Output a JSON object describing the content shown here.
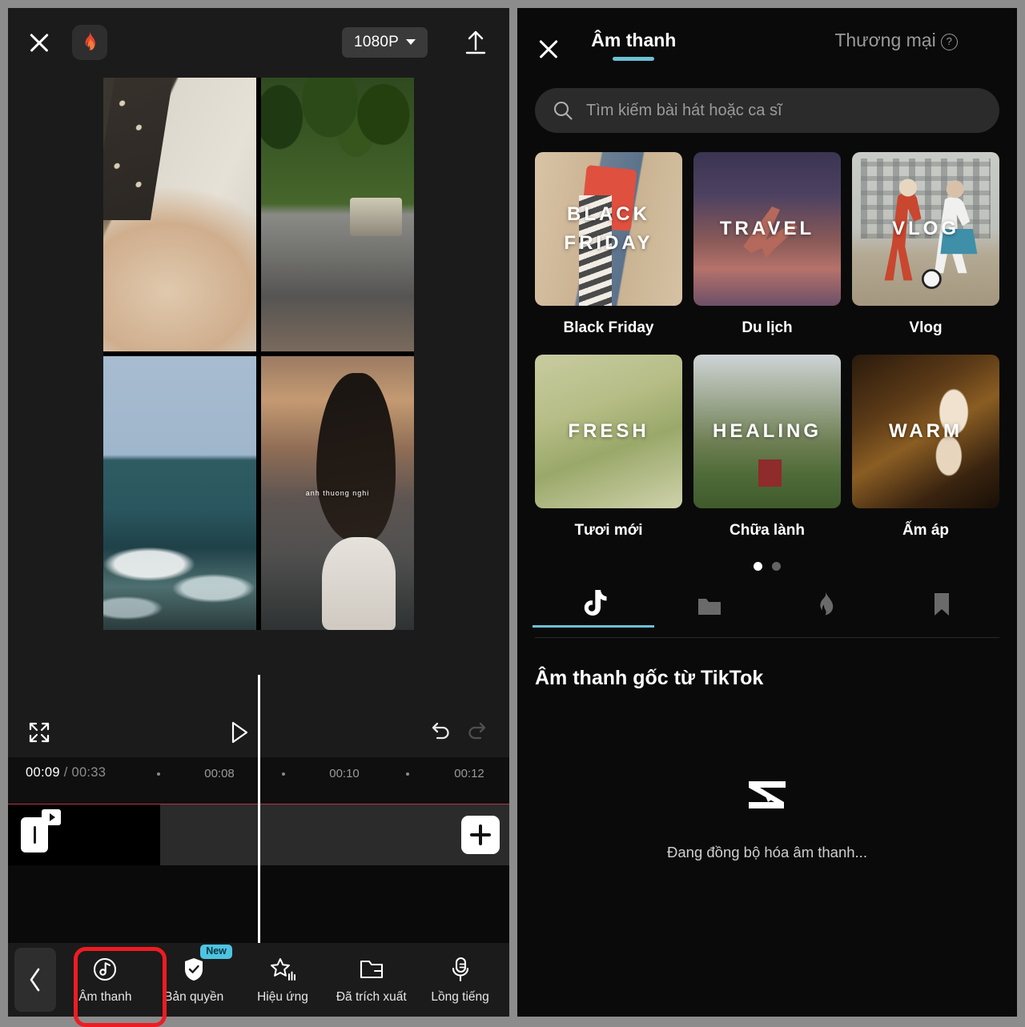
{
  "editor": {
    "close_label": "×",
    "brand_icon": "flame-icon",
    "resolution": "1080P",
    "export_icon": "upload-icon",
    "preview": {
      "cells": [
        {
          "name": "cat-clip",
          "caption": ""
        },
        {
          "name": "street-clip",
          "caption": ""
        },
        {
          "name": "sea-clip",
          "caption": ""
        },
        {
          "name": "girl-clip",
          "caption": "anh thuong nghi"
        }
      ]
    },
    "controls": {
      "fullscreen_icon": "expand-icon",
      "play_icon": "play-icon",
      "undo_icon": "undo-icon",
      "redo_icon": "redo-icon"
    },
    "timeline": {
      "current_time": "00:09",
      "separator": "/",
      "total_time": "00:33",
      "ticks": [
        "00:08",
        "00:10",
        "00:12"
      ],
      "add_label": "+"
    },
    "toolbar": {
      "back_icon": "chevron-left-icon",
      "items": [
        {
          "label": "Âm thanh",
          "icon": "music-note-icon",
          "badge": "",
          "highlighted": true
        },
        {
          "label": "Bản quyền",
          "icon": "shield-check-icon",
          "badge": "New",
          "highlighted": false
        },
        {
          "label": "Hiệu ứng",
          "icon": "star-effect-icon",
          "badge": "",
          "highlighted": false
        },
        {
          "label": "Đã trích xuất",
          "icon": "folder-extract-icon",
          "badge": "",
          "highlighted": false
        },
        {
          "label": "Lồng tiếng",
          "icon": "microphone-icon",
          "badge": "",
          "highlighted": false
        }
      ]
    }
  },
  "audio_panel": {
    "close_label": "×",
    "tabs": [
      {
        "label": "Âm thanh",
        "active": true
      },
      {
        "label": "Thương mại",
        "active": false,
        "help": "?"
      }
    ],
    "search": {
      "placeholder": "Tìm kiếm bài hát hoặc ca sĩ",
      "icon": "search-icon"
    },
    "categories": [
      {
        "name": "Black Friday",
        "art_text": "BLACK\nFRIDAY",
        "art": "bf"
      },
      {
        "name": "Du lịch",
        "art_text": "TRAVEL",
        "art": "tr"
      },
      {
        "name": "Vlog",
        "art_text": "VLOG",
        "art": "vl"
      },
      {
        "name": "Tươi mới",
        "art_text": "FRESH",
        "art": "fr"
      },
      {
        "name": "Chữa lành",
        "art_text": "HEALING",
        "art": "he"
      },
      {
        "name": "Ấm áp",
        "art_text": "WARM",
        "art": "wa"
      }
    ],
    "carousel": {
      "pages": 2,
      "active": 0
    },
    "source_tabs": [
      {
        "icon": "tiktok-icon",
        "active": true
      },
      {
        "icon": "folder-icon",
        "active": false
      },
      {
        "icon": "flame-icon",
        "active": false
      },
      {
        "icon": "bookmark-icon",
        "active": false
      }
    ],
    "section_title": "Âm thanh gốc từ TikTok",
    "empty_state": {
      "icon": "capcut-logo-icon",
      "message": "Đang đồng bộ hóa âm thanh..."
    }
  },
  "colors": {
    "accent_teal": "#6cc1d4",
    "highlight_red": "#ee1c22",
    "badge_cyan": "#4ec3e0",
    "panel_bg": "#0a0a0a",
    "editor_bg": "#1b1b1b"
  }
}
